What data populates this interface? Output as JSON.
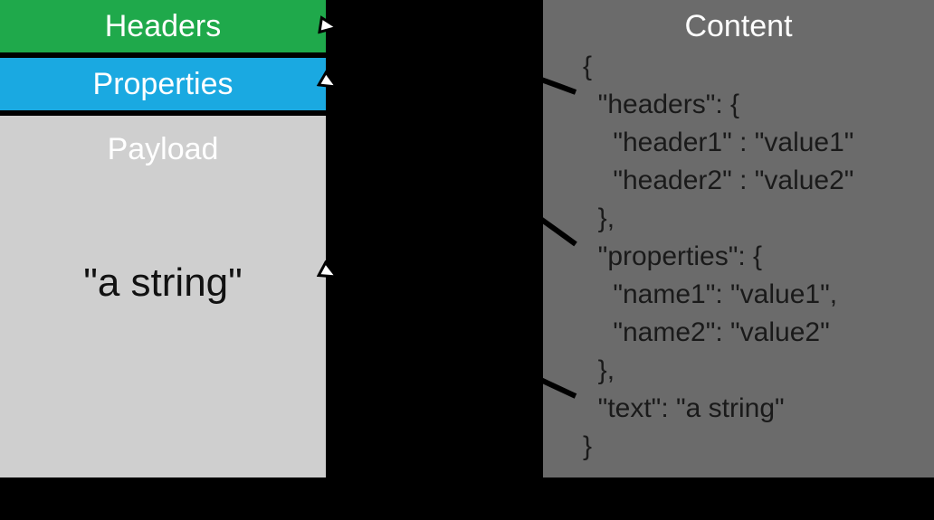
{
  "left": {
    "headers_label": "Headers",
    "properties_label": "Properties",
    "payload_label": "Payload",
    "payload_value": "\"a string\""
  },
  "right": {
    "title": "Content",
    "lines": [
      "{",
      "  \"headers\": {",
      "    \"header1\" : \"value1\"",
      "    \"header2\" : \"value2\"",
      "  },",
      "  \"properties\": {",
      "    \"name1\": \"value1\",",
      "    \"name2\": \"value2\"",
      "  },",
      "  \"text\": \"a string\"",
      "}"
    ]
  }
}
